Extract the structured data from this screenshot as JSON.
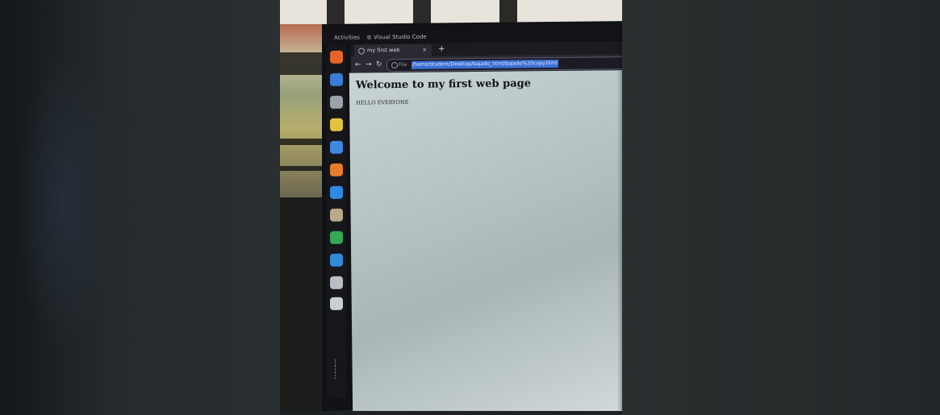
{
  "topbar": {
    "activities": "Activities",
    "app_name": "Visual Studio Code"
  },
  "browser": {
    "tab_title": "my first web",
    "tab_close": "×",
    "new_tab": "+",
    "back": "←",
    "forward": "→",
    "reload": "↻",
    "url_scheme": "File",
    "url": "/home/student/Desktop/bajado_html/bajado%20copy.html"
  },
  "page": {
    "heading": "Welcome to my first web page",
    "text": "HELLO EVERYONE"
  },
  "dock": [
    {
      "name": "firefox-icon",
      "color": "#e8632b"
    },
    {
      "name": "thunderbird-icon",
      "color": "#3a7bd5"
    },
    {
      "name": "files-icon",
      "color": "#9aa3ab"
    },
    {
      "name": "rhythmbox-icon",
      "color": "#e3c23c"
    },
    {
      "name": "writer-icon",
      "color": "#3f86e0"
    },
    {
      "name": "software-icon",
      "color": "#e87d2c"
    },
    {
      "name": "help-icon",
      "color": "#2f8ae6"
    },
    {
      "name": "archive-icon",
      "color": "#b9a98a"
    },
    {
      "name": "chrome-icon",
      "color": "#36a853"
    },
    {
      "name": "vscode-icon",
      "color": "#2f8bd9"
    },
    {
      "name": "drive-icon",
      "color": "#b8bec4"
    },
    {
      "name": "trash-icon",
      "color": "#c8ced4"
    }
  ],
  "apps_grid_icon": "⋮⋮⋮"
}
